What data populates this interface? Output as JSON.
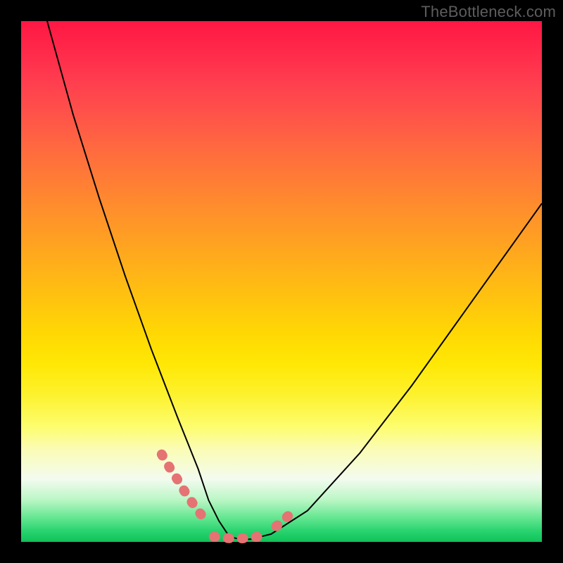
{
  "watermark": "TheBottleneck.com",
  "chart_data": {
    "type": "line",
    "title": "",
    "xlabel": "",
    "ylabel": "",
    "xlim": [
      0,
      100
    ],
    "ylim": [
      0,
      100
    ],
    "series": [
      {
        "name": "curve",
        "x": [
          5,
          10,
          15,
          20,
          25,
          30,
          32,
          34,
          36,
          38,
          40,
          42,
          44,
          48,
          55,
          65,
          75,
          85,
          95,
          100
        ],
        "y": [
          100,
          82,
          66,
          51,
          37,
          24,
          19,
          14,
          8,
          4,
          1,
          0.5,
          0.5,
          1.5,
          6,
          17,
          30,
          44,
          58,
          65
        ]
      },
      {
        "name": "highlight-left",
        "x": [
          27,
          28.5,
          30,
          31.2,
          32.4,
          33.5,
          34.6
        ],
        "y": [
          16.8,
          14.3,
          12.0,
          10.0,
          8.2,
          6.6,
          5.2
        ]
      },
      {
        "name": "highlight-bottom",
        "x": [
          37,
          38.5,
          40,
          41.5,
          43,
          44.5,
          46
        ],
        "y": [
          1.0,
          0.8,
          0.7,
          0.65,
          0.7,
          0.85,
          1.1
        ]
      },
      {
        "name": "highlight-right",
        "x": [
          49,
          50.2,
          51.4,
          52.6
        ],
        "y": [
          3.0,
          4.0,
          5.1,
          6.3
        ]
      }
    ],
    "colors": {
      "curve": "#000000",
      "highlight": "#e57373",
      "gradient_top": "#ff1744",
      "gradient_mid": "#ffd700",
      "gradient_bottom": "#0fc158"
    }
  }
}
